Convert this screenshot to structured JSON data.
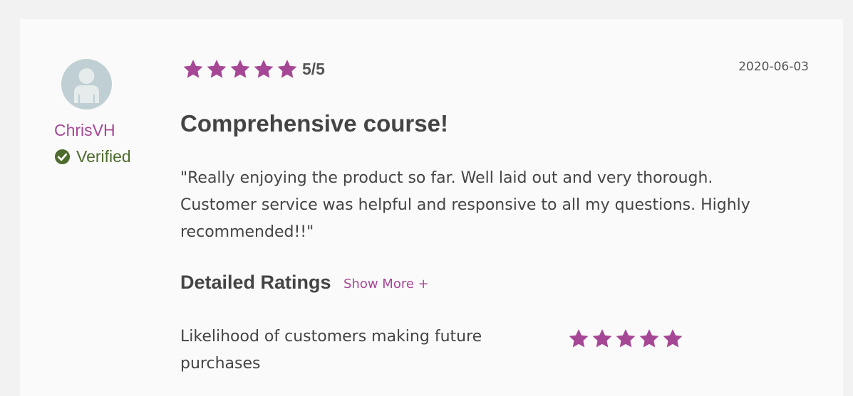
{
  "colors": {
    "accent": "#a64796",
    "verified": "#4e6b2e",
    "star": "#a64796",
    "avatar_bg": "#bfcfd3"
  },
  "reviewer": {
    "avatar_icon": "user-silhouette-icon",
    "name": "ChrisVH",
    "verified_icon": "check-circle-icon",
    "verified_label": "Verified"
  },
  "review": {
    "rating": 5,
    "rating_max": 5,
    "rating_text": "5/5",
    "date": "2020-06-03",
    "title": "Comprehensive course!",
    "body": "\"Really enjoying the product so far. Well laid out and very thorough. Customer service was helpful and responsive to all my questions. Highly recommended!!\""
  },
  "detailed_ratings": {
    "heading": "Detailed Ratings",
    "show_more_label": "Show More +",
    "items": [
      {
        "label": "Likelihood of customers making future purchases",
        "rating": 5,
        "rating_max": 5
      }
    ]
  }
}
